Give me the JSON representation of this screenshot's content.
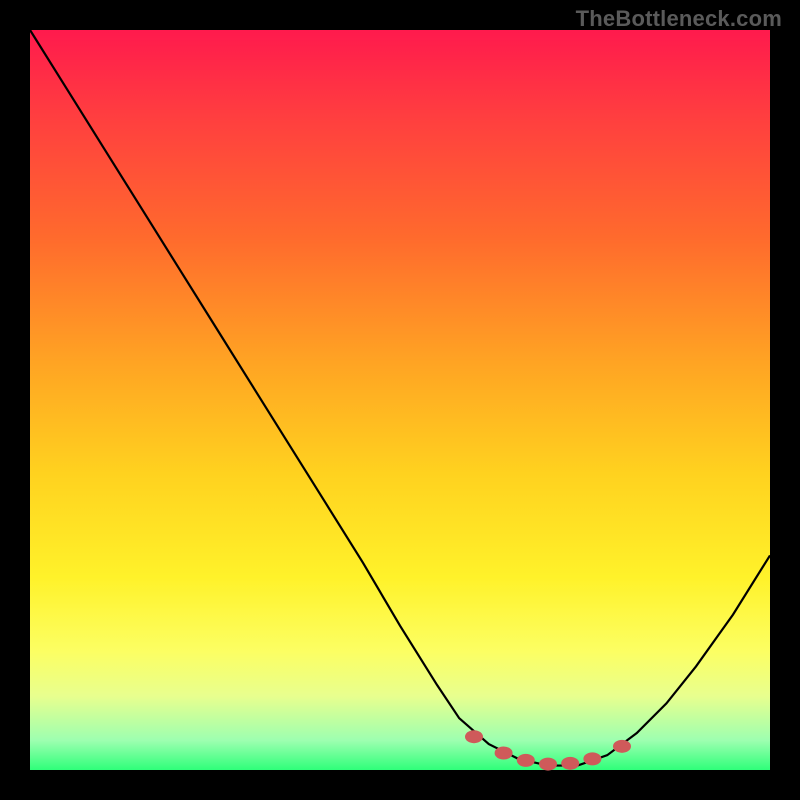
{
  "watermark": "TheBottleneck.com",
  "chart_data": {
    "type": "line",
    "title": "",
    "xlabel": "",
    "ylabel": "",
    "xlim": [
      0,
      100
    ],
    "ylim": [
      0,
      100
    ],
    "series": [
      {
        "name": "bottleneck-curve",
        "x": [
          0,
          5,
          10,
          15,
          20,
          25,
          30,
          35,
          40,
          45,
          50,
          55,
          58,
          62,
          66,
          70,
          74,
          78,
          82,
          86,
          90,
          95,
          100
        ],
        "values": [
          100,
          92,
          84,
          76,
          68,
          60,
          52,
          44,
          36,
          28,
          19.5,
          11.5,
          7,
          3.5,
          1.5,
          0.6,
          0.6,
          2,
          5,
          9,
          14,
          21,
          29
        ]
      }
    ],
    "markers": {
      "name": "low-bottleneck-dots",
      "color": "#cf5a5a",
      "x": [
        60,
        64,
        67,
        70,
        73,
        76,
        80
      ],
      "values": [
        4.5,
        2.3,
        1.3,
        0.8,
        0.9,
        1.5,
        3.2
      ]
    }
  }
}
